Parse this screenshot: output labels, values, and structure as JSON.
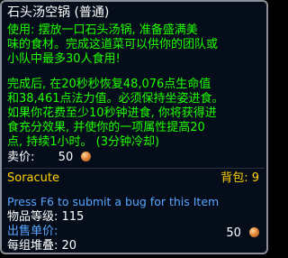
{
  "tooltip": {
    "title": "石头汤空锅 (普通)",
    "use_lines": [
      "使用:  摆放一口石头汤锅, 准备盛满美",
      "味的食材。完成这道菜可以供你的团队或",
      "小队中最多30人食用!"
    ],
    "completed_lines": [
      "完成后, 在20秒秒恢复48,076点生命值",
      "和38,461点法力值。必须保持坐姿进食。",
      "如果你花费至少10秒钟进食, 你将获得进",
      "食充分效果, 并使你的一项属性提高20",
      "点, 持续1小时。 (3分钟冷却)"
    ],
    "sell_label": "卖价:",
    "sell_amount": "50",
    "owner_name": "Soracute",
    "bag_label": "背包: 9",
    "bug_report": "Press F6 to submit a bug for this Item",
    "item_level": "物品等级: 115",
    "price_label": "出售单价:",
    "price_amount": "50",
    "stack_label": "每组堆叠: 20",
    "icons": {
      "coin": "copper-coin-icon"
    },
    "colors": {
      "use_text": "#1eff00",
      "gold": "#ffd100",
      "link": "#58a6ff",
      "background": "#060d1a",
      "border": "#8a8f98"
    }
  }
}
